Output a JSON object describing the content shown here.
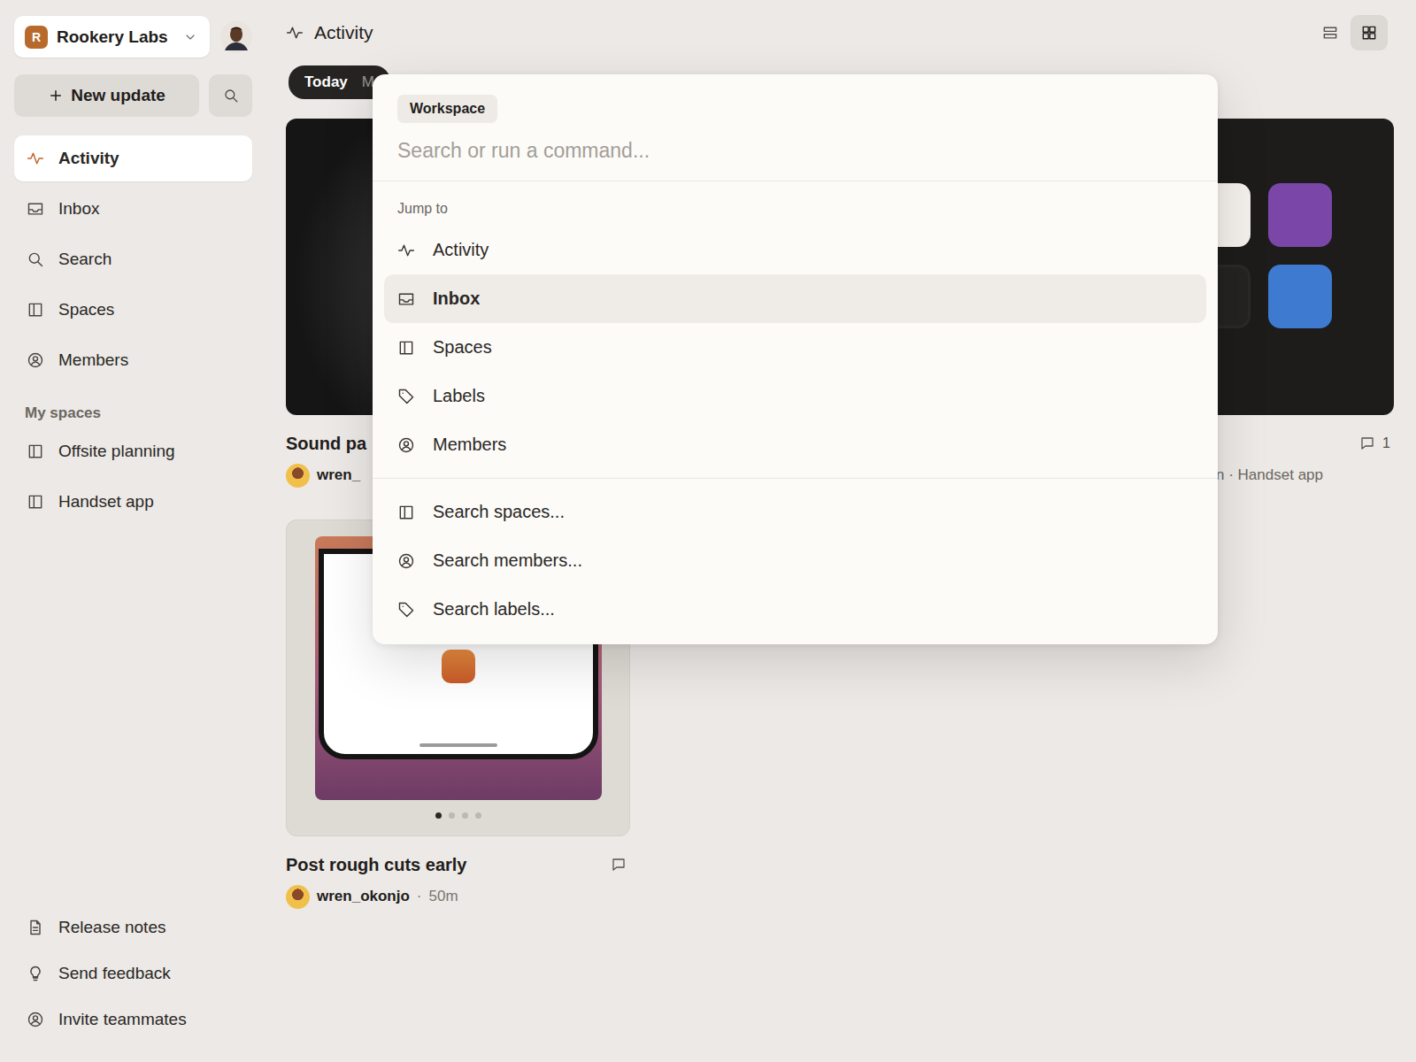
{
  "workspace": {
    "name": "Rookery Labs",
    "initial": "R"
  },
  "sidebar": {
    "new_button": "New update",
    "nav": [
      {
        "label": "Activity",
        "kind": "activity",
        "selected": true
      },
      {
        "label": "Inbox",
        "kind": "inbox",
        "selected": false
      },
      {
        "label": "Search",
        "kind": "search",
        "selected": false
      },
      {
        "label": "Spaces",
        "kind": "spaces",
        "selected": false
      },
      {
        "label": "Members",
        "kind": "members",
        "selected": false
      }
    ],
    "section": "My spaces",
    "spaces": [
      {
        "label": "Offsite planning"
      },
      {
        "label": "Handset app"
      }
    ],
    "footer": [
      {
        "label": "Release notes",
        "kind": "doc"
      },
      {
        "label": "Send feedback",
        "kind": "bulb"
      },
      {
        "label": "Invite teammates",
        "kind": "members"
      }
    ]
  },
  "header": {
    "title": "Activity",
    "views": [
      {
        "kind": "list",
        "selected": false
      },
      {
        "kind": "grid",
        "selected": true
      }
    ]
  },
  "filters": [
    {
      "label": "Today",
      "selected": true
    },
    {
      "label": "M",
      "selected": false
    }
  ],
  "cards": [
    {
      "kind": "photo",
      "title": "Sound pa",
      "author": "wren_",
      "time": "",
      "comments": "",
      "meta": "",
      "dots": []
    },
    {
      "kind": "icons",
      "title": "",
      "author": "",
      "time": "",
      "comments": "1",
      "meta": "n · Handset app",
      "dots": []
    },
    {
      "kind": "phone",
      "title": "Post rough cuts early",
      "author": "wren_okonjo",
      "time": "50m",
      "comments": "",
      "meta": "",
      "dots": [
        {
          "selected": true
        },
        {
          "selected": false
        },
        {
          "selected": false
        },
        {
          "selected": false
        }
      ]
    }
  ],
  "palette": {
    "scope": "Workspace",
    "placeholder": "Search or run a command...",
    "section": "Jump to",
    "jump": [
      {
        "label": "Activity",
        "kind": "activity",
        "selected": false
      },
      {
        "label": "Inbox",
        "kind": "inbox",
        "selected": true
      },
      {
        "label": "Spaces",
        "kind": "spaces",
        "selected": false
      },
      {
        "label": "Labels",
        "kind": "labels",
        "selected": false
      },
      {
        "label": "Members",
        "kind": "members",
        "selected": false
      }
    ],
    "searches": [
      {
        "label": "Search spaces...",
        "kind": "spaces",
        "selected": false
      },
      {
        "label": "Search members...",
        "kind": "members",
        "selected": false
      },
      {
        "label": "Search labels...",
        "kind": "labels",
        "selected": false
      }
    ]
  }
}
